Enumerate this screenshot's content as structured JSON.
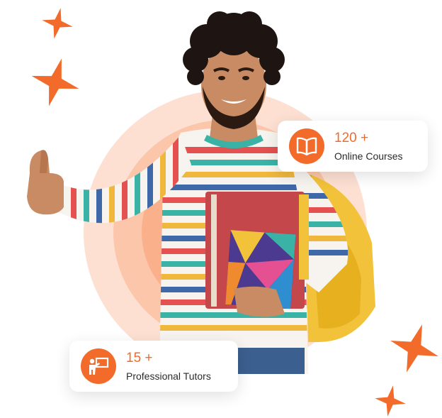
{
  "colors": {
    "accent": "#f26b2a",
    "ring_outer": "#fde0d2",
    "ring_mid": "#fcc6ab",
    "ring_inner": "#fbb08c"
  },
  "hero_image": {
    "subject": "smiling student with curly hair giving a thumbs up, holding books and a yellow backpack",
    "shirt": "white with multicolor horizontal stripes"
  },
  "stats": {
    "courses": {
      "icon": "open-book-icon",
      "value": "120 +",
      "label": "Online Courses"
    },
    "tutors": {
      "icon": "teacher-board-icon",
      "value": "15 +",
      "label": "Professional Tutors"
    }
  },
  "decorations": {
    "stars": [
      "star-icon",
      "star-icon",
      "star-icon",
      "star-icon"
    ]
  }
}
